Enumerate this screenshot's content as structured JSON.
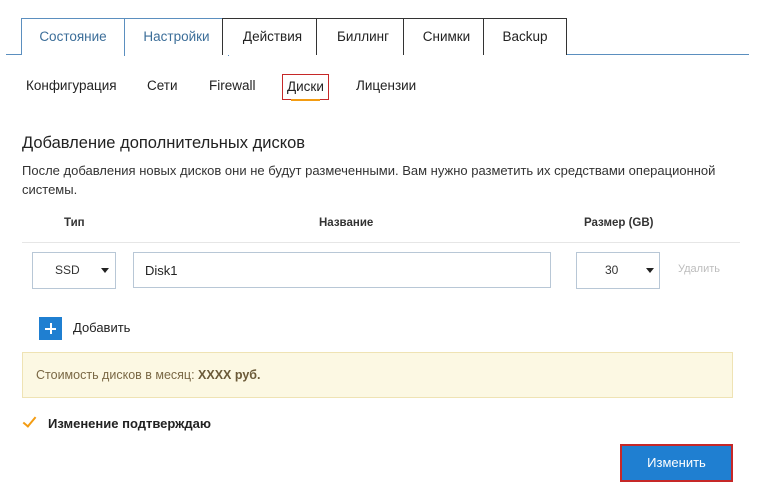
{
  "top_tabs": [
    {
      "label": "Состояние"
    },
    {
      "label": "Настройки"
    },
    {
      "label": "Действия"
    },
    {
      "label": "Биллинг"
    },
    {
      "label": "Снимки"
    },
    {
      "label": "Backup"
    }
  ],
  "active_top_tab": "Настройки",
  "sub_tabs": [
    {
      "label": "Конфигурация"
    },
    {
      "label": "Сети"
    },
    {
      "label": "Firewall"
    },
    {
      "label": "Диски"
    },
    {
      "label": "Лицензии"
    }
  ],
  "active_sub_tab": "Диски",
  "section": {
    "title": "Добавление дополнительных дисков",
    "description": "После добавления новых дисков они не будут размеченными. Вам нужно разметить их средствами операционной системы."
  },
  "table": {
    "headers": {
      "type": "Тип",
      "name": "Название",
      "size": "Размер (GB)"
    },
    "rows": [
      {
        "type": "SSD",
        "name": "Disk1",
        "size": "30",
        "delete_label": "Удалить"
      }
    ]
  },
  "add_label": "Добавить",
  "cost": {
    "label": "Стоимость дисков в месяц:",
    "value": "XXXX руб."
  },
  "confirm": {
    "label": "Изменение подтверждаю",
    "checked": true
  },
  "submit_label": "Изменить",
  "colors": {
    "accent": "#1f7fd1",
    "highlight_border": "#c62828",
    "checkmark": "#f39c12",
    "notice_bg": "#fcf8e3"
  }
}
